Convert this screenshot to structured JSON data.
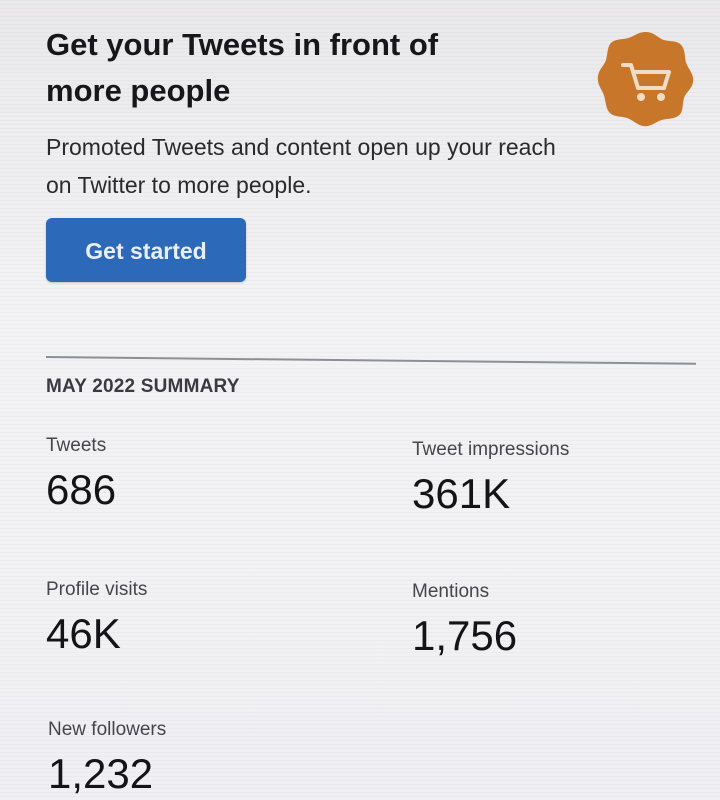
{
  "promo": {
    "title": "Get your Tweets in front of more people",
    "description": "Promoted Tweets and content open up your reach on Twitter to more people.",
    "cta_label": "Get started",
    "badge_icon": "cart-icon",
    "badge_color": "#c8762a",
    "cta_color": "#2c69b8"
  },
  "summary": {
    "title": "MAY 2022 SUMMARY",
    "stats": {
      "tweets": {
        "label": "Tweets",
        "value": "686"
      },
      "impressions": {
        "label": "Tweet impressions",
        "value": "361K"
      },
      "profile_visits": {
        "label": "Profile visits",
        "value": "46K"
      },
      "mentions": {
        "label": "Mentions",
        "value": "1,756"
      },
      "new_followers": {
        "label": "New followers",
        "value": "1,232"
      }
    }
  }
}
